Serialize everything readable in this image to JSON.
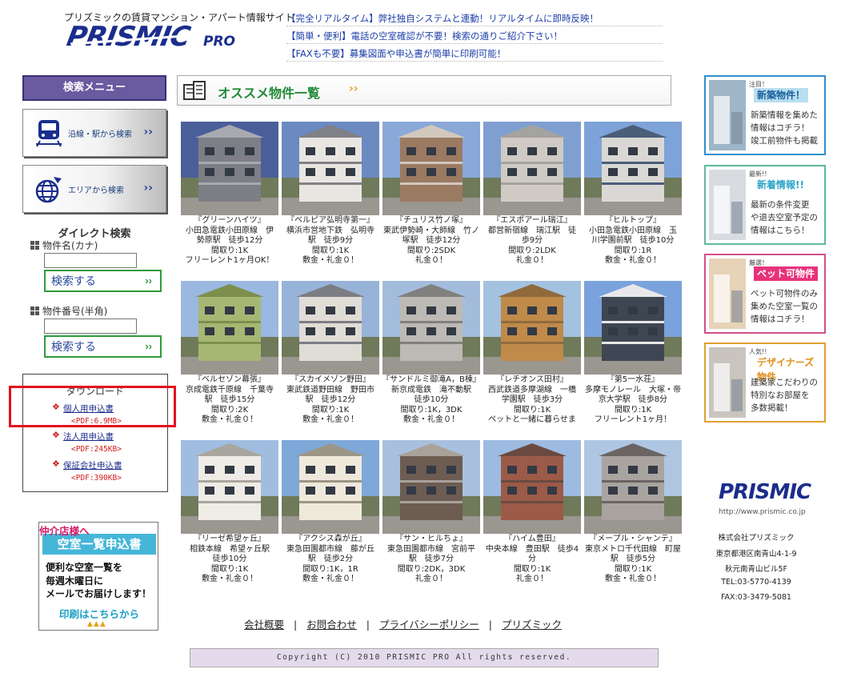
{
  "header": {
    "tagline": "プリズミックの賃貸マンション・アパート情報サイト",
    "logo_text": "PRISMIC",
    "logo_sub": "PRO",
    "news": [
      "【完全リアルタイム】弊社独自システムと連動！リアルタイムに即時反映！",
      "【簡単・便利】電話の空室確認が不要！検索の通りご紹介下さい！",
      "【FAXも不要】募集図面や申込書が簡単に印刷可能！"
    ]
  },
  "left": {
    "search_menu_title": "検索メニュー",
    "line_station_search": "沿線・駅から検索",
    "area_search": "エリアから検索",
    "direct_search_title": "ダイレクト検索",
    "property_name_label": "物件名(カナ)",
    "property_name_value": "",
    "property_number_label": "物件番号(半角)",
    "property_number_value": "",
    "search_button": "検索する",
    "download_title": "ダウンロード",
    "downloads": [
      {
        "name": "個人用申込書",
        "size": "<PDF:6.9MB>"
      },
      {
        "name": "法人用申込書",
        "size": "<PDF:245KB>"
      },
      {
        "name": "保証会社申込書",
        "size": "<PDF:390KB>"
      }
    ],
    "agent_banner": {
      "ribbon": "仲介店様へ",
      "title": "空室一覧申込書",
      "desc": "便利な空室一覧を\n毎週木曜日に\nメールでお届けします！",
      "cta": "印刷はこちらから"
    }
  },
  "center": {
    "section_title": "オススメ物件一覧",
    "properties": [
      {
        "name": "『グリーンハイツ』",
        "line1": "小田急電鉄小田原線　伊",
        "line2": "勢原駅　徒歩12分",
        "layout": "間取り:1K",
        "note": "フリーレント1ヶ月OK！"
      },
      {
        "name": "『ベルピア弘明寺第一』",
        "line1": "横浜市営地下鉄　弘明寺",
        "line2": "駅　徒歩9分",
        "layout": "間取り:1K",
        "note": "敷金・礼金０！"
      },
      {
        "name": "『チュリス竹ノ塚』",
        "line1": "東武伊勢崎・大師線　竹ノ",
        "line2": "塚駅　徒歩12分",
        "layout": "間取り:2SDK",
        "note": "礼金０！"
      },
      {
        "name": "『エスポアール瑞江』",
        "line1": "都営新宿線　瑞江駅　徒",
        "line2": "歩9分",
        "layout": "間取り:2LDK",
        "note": "礼金０！"
      },
      {
        "name": "『ヒルトップ』",
        "line1": "小田急電鉄小田原線　玉",
        "line2": "川学園前駅　徒歩10分",
        "layout": "間取り:1R",
        "note": "敷金・礼金０！"
      },
      {
        "name": "『ベルセゾン幕張』",
        "line1": "京成電鉄千原線　千葉寺",
        "line2": "駅　徒歩15分",
        "layout": "間取り:2K",
        "note": "敷金・礼金０！"
      },
      {
        "name": "『スカイメゾン野田』",
        "line1": "東武鉄道野田線　野田市",
        "line2": "駅　徒歩12分",
        "layout": "間取り:1K",
        "note": "敷金・礼金０！"
      },
      {
        "name": "『サンドルミ御滝A，B棟』",
        "line1": "新京成電鉄　滝不動駅",
        "line2": "徒歩10分",
        "layout": "間取り:1K，3DK",
        "note": "敷金・礼金０！"
      },
      {
        "name": "『レチオンス田村』",
        "line1": "西武鉄道多摩湖線　一橋",
        "line2": "学園駅　徒歩3分",
        "layout": "間取り:1K",
        "note": "ペットと一緒に暮らせま"
      },
      {
        "name": "『第5一水荘』",
        "line1": "多摩モノレール　大塚・帝",
        "line2": "京大学駅　徒歩8分",
        "layout": "間取り:1K",
        "note": "フリーレント1ヶ月！"
      },
      {
        "name": "『リーゼ希望ヶ丘』",
        "line1": "相鉄本線　希望ヶ丘駅",
        "line2": "徒歩10分",
        "layout": "間取り:1K",
        "note": "敷金・礼金０！"
      },
      {
        "name": "『アクシス森が丘』",
        "line1": "東急田園都市線　藤が丘",
        "line2": "駅　徒歩2分",
        "layout": "間取り:1K，1R",
        "note": "敷金・礼金０！"
      },
      {
        "name": "『サン・ヒルちょ』",
        "line1": "東急田園都市線　宮前平",
        "line2": "駅　徒歩7分",
        "layout": "間取り:2DK，3DK",
        "note": "礼金０！"
      },
      {
        "name": "『ハイム豊田』",
        "line1": "中央本線　豊田駅　徒歩4",
        "line2": "分",
        "layout": "間取り:1K",
        "note": "礼金０！"
      },
      {
        "name": "『メープル・シャンテ』",
        "line1": "東京メトロ千代田線　町屋",
        "line2": "駅　徒歩5分",
        "layout": "間取り:1K",
        "note": "敷金・礼金０！"
      }
    ]
  },
  "right": {
    "banners": [
      {
        "small": "注目！",
        "title": "新築物件！",
        "desc": "新築情報を集めた\n情報はコチラ！\n竣工前物件も掲載",
        "color": "#2f8fd0",
        "title_bg": "#b8dff0",
        "title_color": "#1a5e9a"
      },
      {
        "small": "最新!!",
        "title": "新着情報!!",
        "desc": "最新の条件変更\nや退去空室予定の\n情報はこちら！",
        "color": "#5fb8a0",
        "title_bg": "#ffffff",
        "title_color": "#2aa6c6"
      },
      {
        "small": "厳選！",
        "title": "ペット可物件",
        "desc": "ペット可物件のみ\n集めた空室一覧の\n情報はコチラ！",
        "color": "#d0508a",
        "title_bg": "#e8327a",
        "title_color": "#ffffff"
      },
      {
        "small": "人気!!",
        "title": "デザイナーズ物件",
        "desc": "建築家こだわりの\n特別なお部屋を\n多数掲載！",
        "color": "#e0a030",
        "title_bg": "#ffffff",
        "title_color": "#e0901a"
      }
    ],
    "company_logo": "PRISMIC",
    "company_url": "http://www.prismic.co.jp",
    "company_name": "株式会社プリズミック",
    "address1": "東京都港区南青山4-1-9",
    "address2": "秋元南青山ビル5F",
    "tel": "TEL:03-5770-4139",
    "fax": "FAX:03-3479-5081"
  },
  "footer": {
    "links": [
      "会社概要",
      "お問合わせ",
      "プライバシーポリシー",
      "プリズミック"
    ],
    "copyright": "Copyright (C) 2010 PRISMIC PRO All rights reserved."
  }
}
